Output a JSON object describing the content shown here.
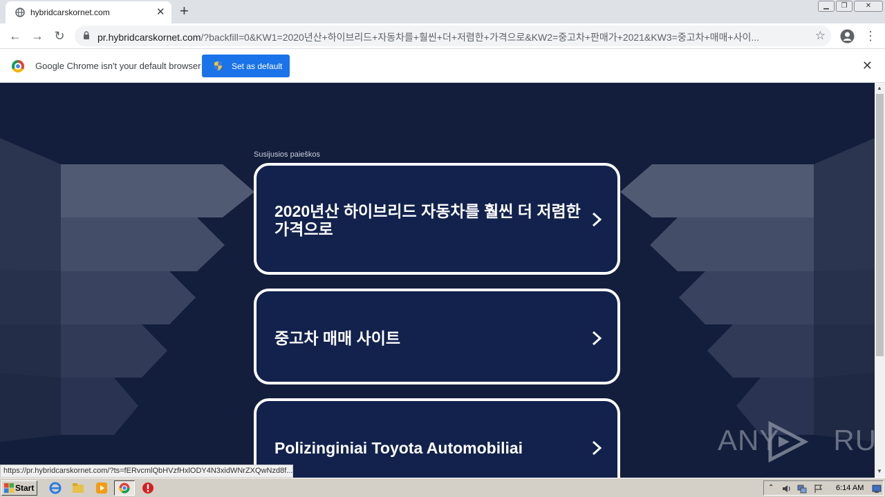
{
  "browser": {
    "tab": {
      "title": "hybridcarskornet.com",
      "close_icon": "close-icon"
    },
    "url": {
      "host": "pr.hybridcarskornet.com",
      "rest": "/?backfill=0&KW1=2020년산+하이브리드+자동차를+훨씬+더+저렴한+가격으로&KW2=중고차+판매가+2021&KW3=중고차+매매+사이..."
    },
    "infobar": {
      "message": "Google Chrome isn't your default browser",
      "button_label": "Set as default"
    },
    "status_url": "https://pr.hybridcarskornet.com/?ts=fERvcmlQbHVzfHxlODY4N3xidWNrZXQwNzd8f..."
  },
  "page": {
    "section_label": "Susijusios paieškos",
    "results": [
      {
        "label": "2020년산 하이브리드 자동차를 훨씬 더 저렴한 가격으로"
      },
      {
        "label": "중고차 매매 사이트"
      },
      {
        "label": "Polizinginiai Toyota Automobiliai"
      }
    ],
    "background_color": "#131e3c",
    "card_color": "#12224d"
  },
  "watermark": {
    "text_a": "ANY",
    "text_b": "RUN"
  },
  "taskbar": {
    "start_label": "Start",
    "clock": "6:14 AM"
  }
}
